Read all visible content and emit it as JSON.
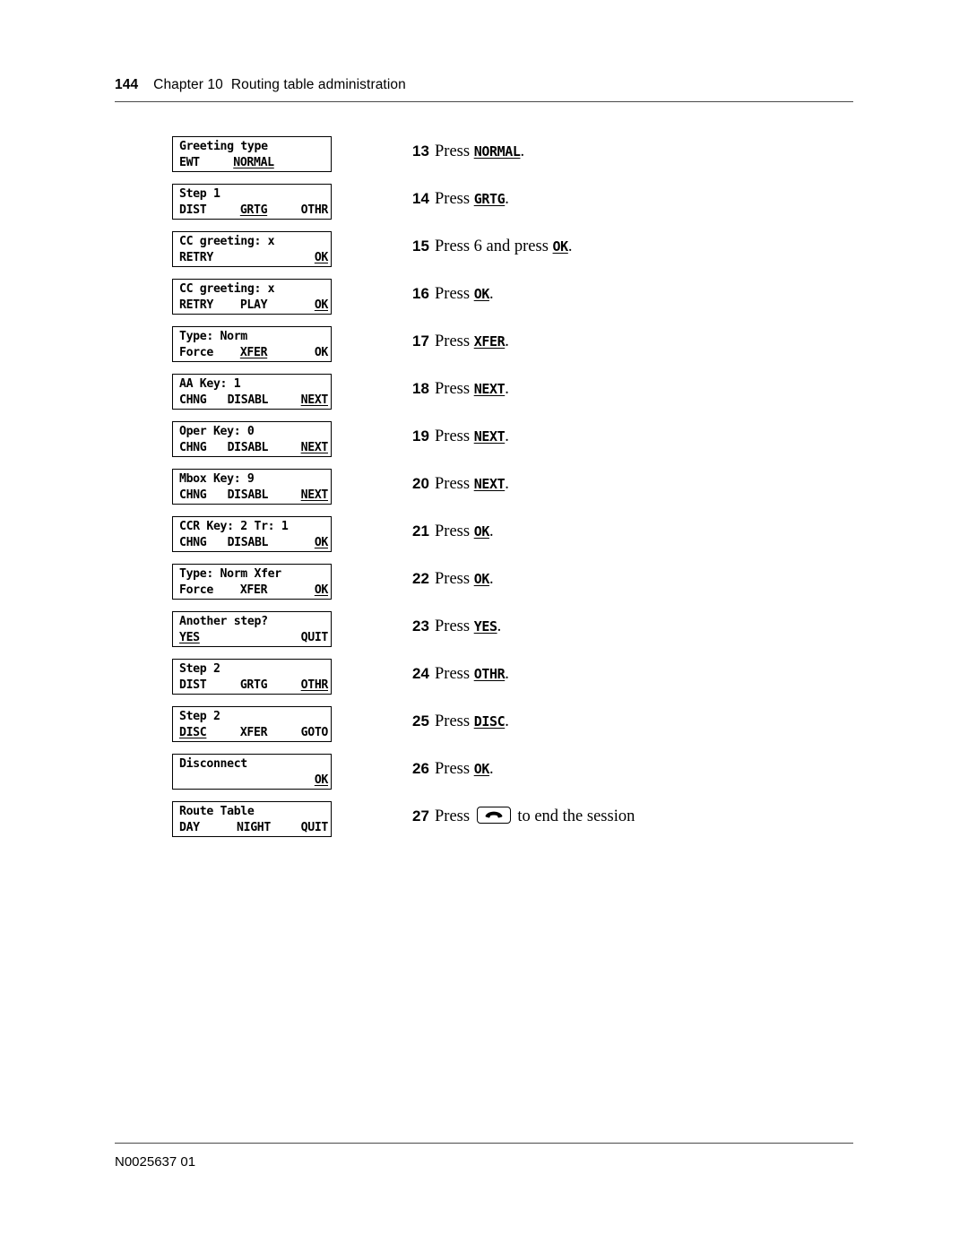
{
  "header": {
    "page_number": "144",
    "chapter_label": "Chapter 10",
    "chapter_title": "Routing table administration"
  },
  "footer": {
    "document_id": "N0025637 01"
  },
  "procedure": {
    "steps": [
      {
        "number": "13",
        "before": "Press ",
        "key": "NORMAL",
        "after": ".",
        "lcd": {
          "line1": "Greeting type",
          "soft_left": "EWT",
          "soft_center": "NORMAL",
          "soft_right": "",
          "underline": "center"
        }
      },
      {
        "number": "14",
        "before": "Press ",
        "key": "GRTG",
        "after": ".",
        "lcd": {
          "line1": "Step 1",
          "soft_left": "DIST",
          "soft_center": "GRTG",
          "soft_right": "OTHR",
          "underline": "center"
        }
      },
      {
        "number": "15",
        "before": "Press 6 and press ",
        "key": "OK",
        "after": ".",
        "lcd": {
          "line1": "CC greeting: x",
          "soft_left": "RETRY",
          "soft_center": "",
          "soft_right": "OK",
          "underline": "right"
        }
      },
      {
        "number": "16",
        "before": "Press ",
        "key": "OK",
        "after": ".",
        "lcd": {
          "line1": "CC greeting: x",
          "soft_left": "RETRY",
          "soft_center": "PLAY",
          "soft_right": "OK",
          "underline": "right"
        }
      },
      {
        "number": "17",
        "before": "Press ",
        "key": "XFER",
        "after": ".",
        "lcd": {
          "line1": "Type: Norm",
          "soft_left": "Force",
          "soft_center": "XFER",
          "soft_right": "OK",
          "underline": "center"
        }
      },
      {
        "number": "18",
        "before": "Press ",
        "key": "NEXT",
        "after": ".",
        "lcd": {
          "line1": "AA Key: 1",
          "soft_left": "CHNG",
          "soft_center": "DISABL",
          "soft_right": "NEXT",
          "underline": "right"
        }
      },
      {
        "number": "19",
        "before": "Press ",
        "key": "NEXT",
        "after": ".",
        "lcd": {
          "line1": "Oper Key: 0",
          "soft_left": "CHNG",
          "soft_center": "DISABL",
          "soft_right": "NEXT",
          "underline": "right"
        }
      },
      {
        "number": "20",
        "before": "Press ",
        "key": "NEXT",
        "after": ".",
        "lcd": {
          "line1": "Mbox Key: 9",
          "soft_left": "CHNG",
          "soft_center": "DISABL",
          "soft_right": "NEXT",
          "underline": "right"
        }
      },
      {
        "number": "21",
        "before": "Press ",
        "key": "OK",
        "after": ".",
        "lcd": {
          "line1": "CCR Key: 2 Tr: 1",
          "soft_left": "CHNG",
          "soft_center": "DISABL",
          "soft_right": "OK",
          "underline": "right"
        }
      },
      {
        "number": "22",
        "before": "Press ",
        "key": "OK",
        "after": ".",
        "lcd": {
          "line1": "Type: Norm Xfer",
          "soft_left": "Force",
          "soft_center": "XFER",
          "soft_right": "OK",
          "underline": "right"
        }
      },
      {
        "number": "23",
        "before": "Press ",
        "key": "YES",
        "after": ".",
        "lcd": {
          "line1": "Another step?",
          "soft_left": "YES",
          "soft_center": "",
          "soft_right": "QUIT",
          "underline": "left"
        }
      },
      {
        "number": "24",
        "before": "Press ",
        "key": "OTHR",
        "after": ".",
        "lcd": {
          "line1": "Step 2",
          "soft_left": "DIST",
          "soft_center": "GRTG",
          "soft_right": "OTHR",
          "underline": "right"
        }
      },
      {
        "number": "25",
        "before": "Press ",
        "key": "DISC",
        "after": ".",
        "lcd": {
          "line1": "Step 2",
          "soft_left": "DISC",
          "soft_center": "XFER",
          "soft_right": "GOTO",
          "underline": "left"
        }
      },
      {
        "number": "26",
        "before": "Press ",
        "key": "OK",
        "after": ".",
        "lcd": {
          "line1": "Disconnect",
          "soft_left": "",
          "soft_center": "",
          "soft_right": "OK",
          "underline": "right"
        }
      },
      {
        "number": "27",
        "before": "Press ",
        "key": "",
        "icon": "release-handset-icon",
        "after": " to end the session",
        "lcd": {
          "line1": "Route Table",
          "soft_left": "DAY",
          "soft_center": "NIGHT",
          "soft_right": "QUIT",
          "underline": "none"
        }
      }
    ]
  }
}
